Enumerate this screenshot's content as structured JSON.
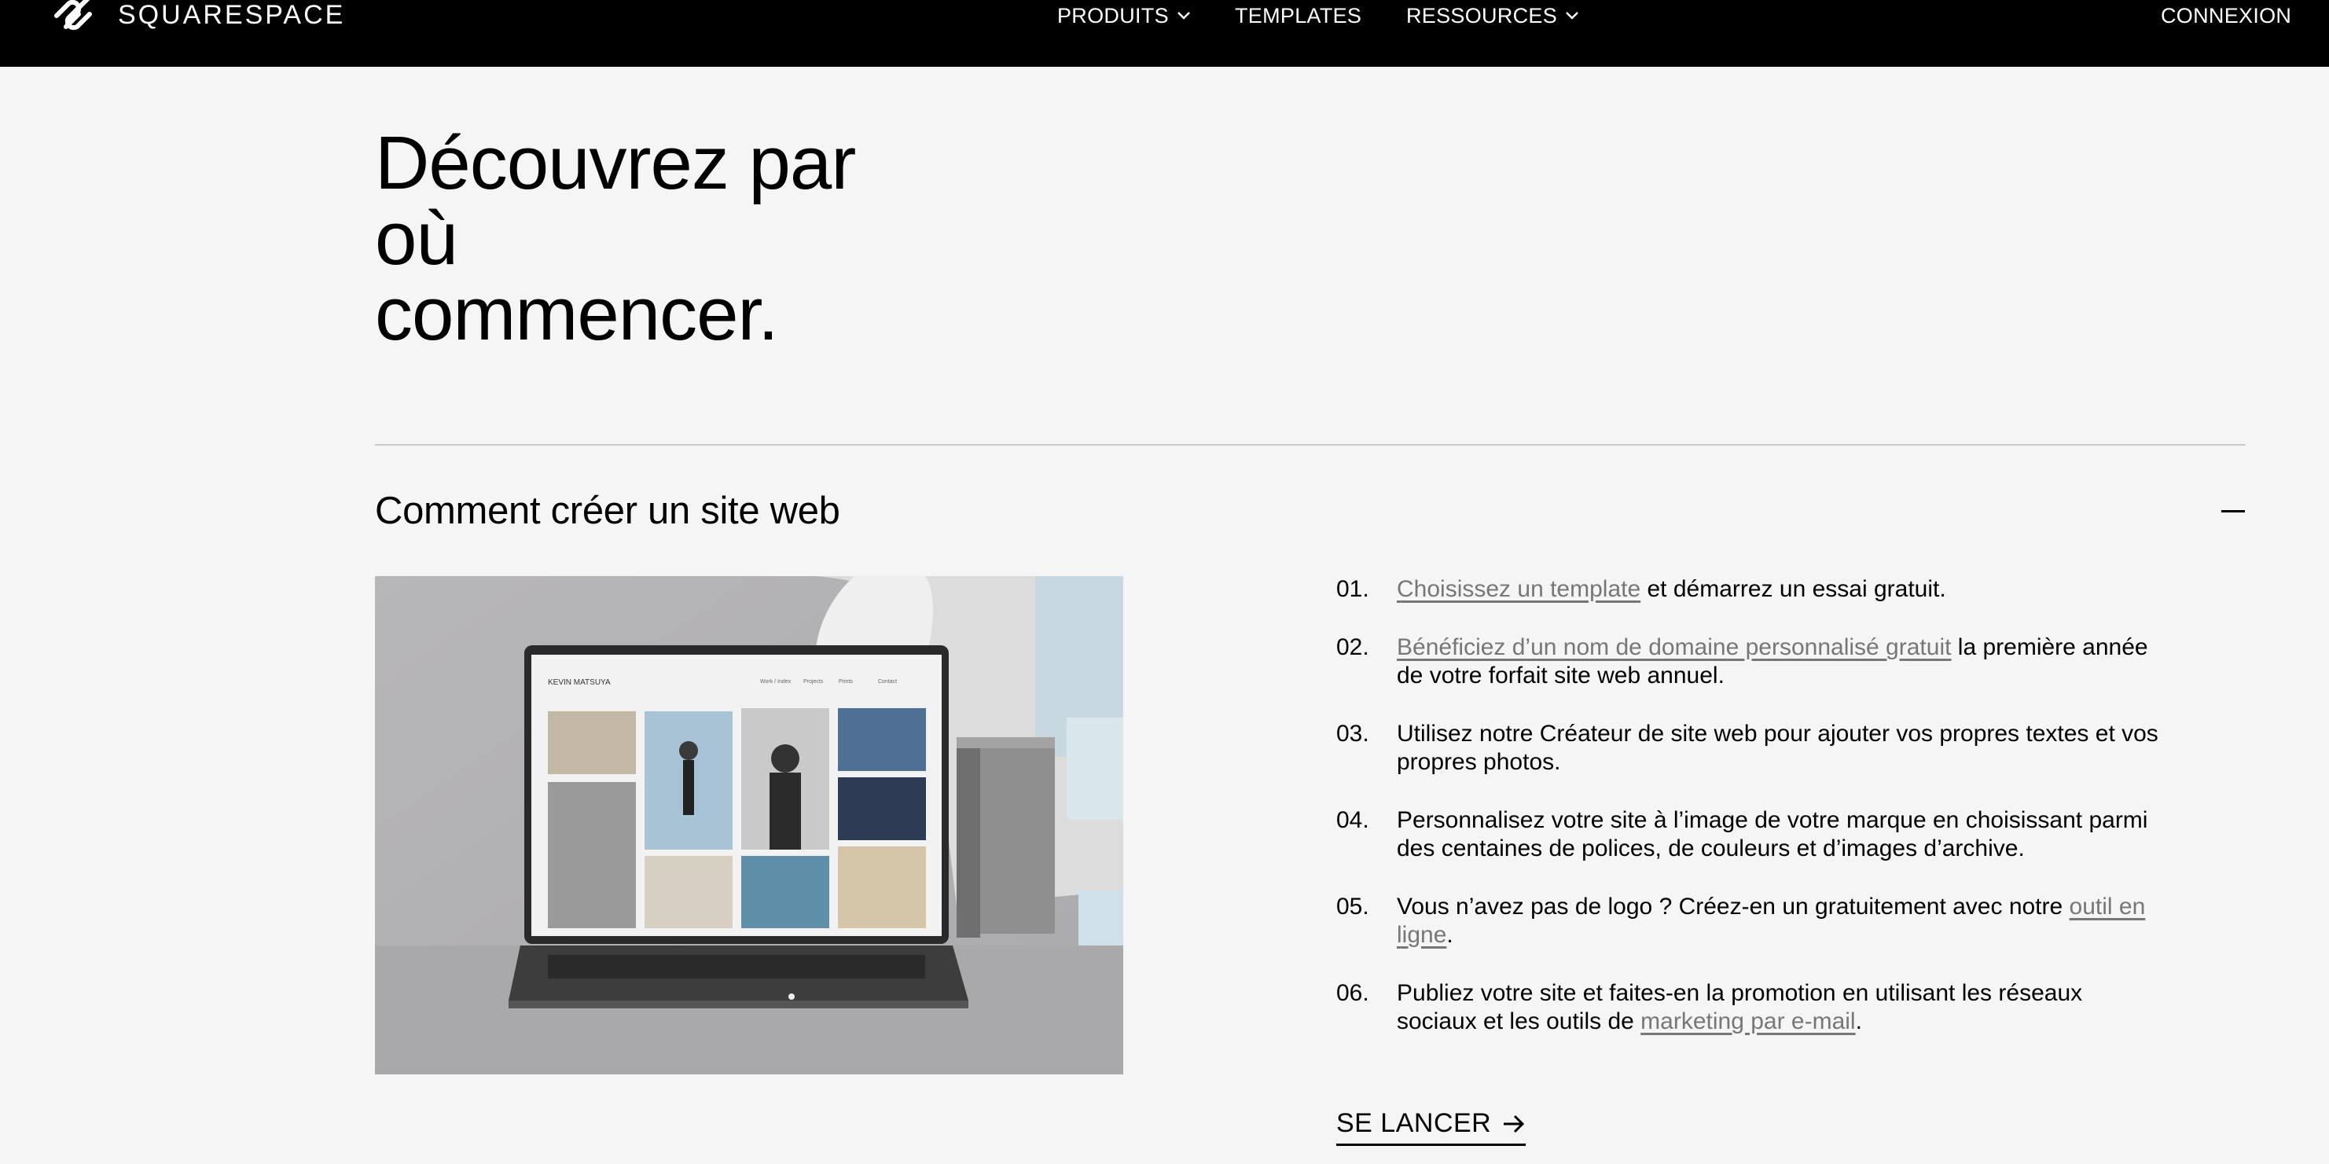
{
  "header": {
    "logo_text": "SQUARESPACE",
    "nav": [
      {
        "label": "PRODUITS",
        "has_dropdown": true
      },
      {
        "label": "TEMPLATES",
        "has_dropdown": false
      },
      {
        "label": "RESSOURCES",
        "has_dropdown": true
      }
    ],
    "login_label": "CONNEXION"
  },
  "hero": {
    "title_lines": [
      "Découvrez par",
      "où",
      "commencer."
    ]
  },
  "accordion": {
    "title": "Comment créer un site web",
    "state": "expanded",
    "toggle_icon": "minus-icon"
  },
  "illustration": {
    "site_name": "KEVIN MATSUYA",
    "menu": [
      "Work / Index",
      "Projects",
      "Prints",
      "Contact"
    ]
  },
  "steps": [
    {
      "num": "01.",
      "link": "Choisissez un template",
      "text_after": " et démarrez un essai gratuit."
    },
    {
      "num": "02.",
      "link": "Bénéficiez d’un nom de domaine personnalisé gratuit",
      "text_after": " la première année de votre forfait site web annuel."
    },
    {
      "num": "03.",
      "text": "Utilisez notre Créateur de site web pour ajouter vos propres textes et vos propres photos."
    },
    {
      "num": "04.",
      "text": "Personnalisez votre site à l’image de votre marque en choisissant parmi des centaines de polices, de couleurs et d’images d’archive."
    },
    {
      "num": "05.",
      "text_before": "Vous n’avez pas de logo ? Créez-en un gratuitement avec notre ",
      "link": "outil en ligne",
      "text_after": "."
    },
    {
      "num": "06.",
      "text_before": "Publiez votre site et faites-en la promotion en utilisant les réseaux sociaux et les outils de ",
      "link": "marketing par e-mail",
      "text_after": "."
    }
  ],
  "cta": {
    "label": "SE LANCER"
  },
  "colors": {
    "nav_bg": "#000000",
    "page_bg": "#f5f5f5",
    "link_gray": "#777777"
  }
}
